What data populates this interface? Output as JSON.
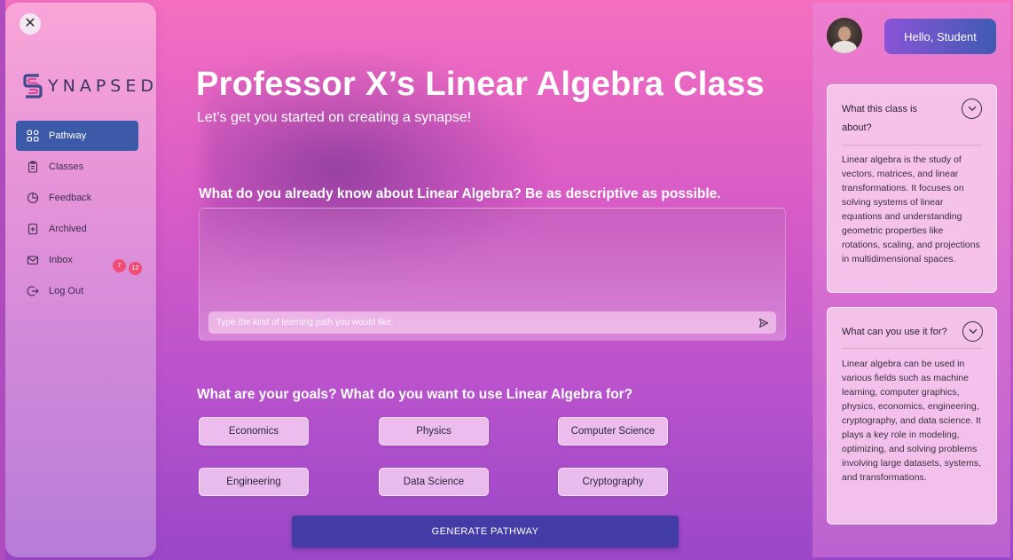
{
  "sidebar": {
    "close_label": "✕",
    "logo_text": "YNAPSED",
    "items": [
      {
        "label": "Pathway",
        "icon": "grid-icon",
        "active": true
      },
      {
        "label": "Classes",
        "icon": "clipboard-icon"
      },
      {
        "label": "Feedback",
        "icon": "pie-chart-icon",
        "badge": "12"
      },
      {
        "label": "Archived",
        "icon": "archive-icon"
      },
      {
        "label": "Inbox",
        "icon": "envelope-icon",
        "badge": "7"
      },
      {
        "label": "Log Out",
        "icon": "logout-icon"
      }
    ]
  },
  "main": {
    "title": "Professor X’s Linear Algebra Class",
    "subtitle": "Let’s get you started on creating a synapse!",
    "question1": "What do you already know about Linear Algebra? Be as descriptive as possible.",
    "prompt_placeholder": "Type the kind of learning path you would like.",
    "question2": "What are your goals? What do you want to use Linear Algebra for?",
    "goals": [
      "Economics",
      "Physics",
      "Computer Science",
      "Engineering",
      "Data Science",
      "Cryptography"
    ],
    "generate_label": "GENERATE PATHWAY"
  },
  "header": {
    "greeting": "Hello, Student"
  },
  "info_cards": [
    {
      "title_line1": "What this class is",
      "title_line2": "about?",
      "body": "Linear algebra is the study of vectors, matrices, and linear transformations. It focuses on solving systems of linear equations and understanding geometric properties like rotations, scaling, and projections in multidimensional spaces."
    },
    {
      "title_line1": "What can you use it for?",
      "body": "Linear algebra can be used in various fields such as machine learning, computer graphics, physics, economics, engineering, cryptography, and data science. It plays a key role in modeling, optimizing, and solving problems involving large datasets, systems, and transformations."
    }
  ],
  "colors": {
    "accent": "#3d5aa8",
    "generate": "#433ca6",
    "badge": "#ef4d74"
  }
}
